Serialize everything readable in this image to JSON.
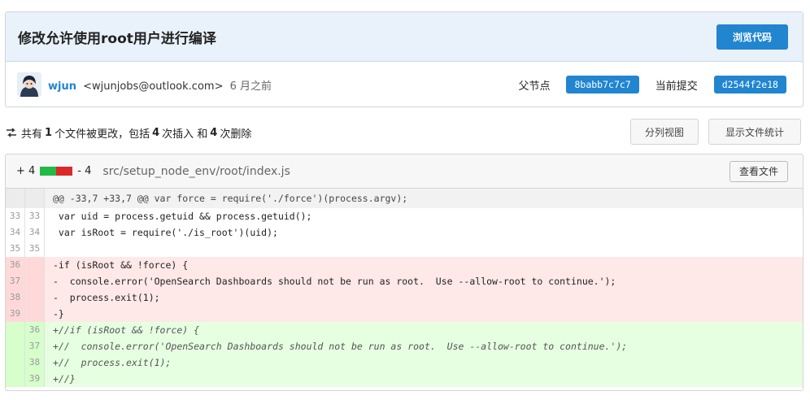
{
  "commit": {
    "title": "修改允许使用root用户进行编译",
    "browse_label": "浏览代码",
    "author_name": "wjun",
    "author_email": "<wjunjobs@outlook.com>",
    "time": "6 月之前",
    "parent_label": "父节点",
    "parent_sha": "8babb7c7c7",
    "current_label": "当前提交",
    "current_sha": "d2544f2e18"
  },
  "stats": {
    "prefix": "共有",
    "files": "1",
    "files_text": "个文件被更改，包括",
    "insertions": "4",
    "insertions_text": "次插入 和",
    "deletions": "4",
    "deletions_text": "次删除",
    "split_label": "分列视图",
    "show_stats_label": "显示文件统计"
  },
  "file": {
    "added": "+ 4",
    "removed": "- 4",
    "path": "src/setup_node_env/root/index.js",
    "view_label": "查看文件"
  },
  "hunk": "@@ -33,7 +33,7 @@ var force = require('./force')(process.argv);",
  "lines": [
    {
      "type": "ctx",
      "old": "33",
      "new": "33",
      "text": " var uid = process.getuid && process.getuid();"
    },
    {
      "type": "ctx",
      "old": "34",
      "new": "34",
      "text": " var isRoot = require('./is_root')(uid);"
    },
    {
      "type": "ctx",
      "old": "35",
      "new": "35",
      "text": " "
    },
    {
      "type": "del",
      "old": "36",
      "new": "",
      "text": "-if (isRoot && !force) {"
    },
    {
      "type": "del",
      "old": "37",
      "new": "",
      "text": "-  console.error('OpenSearch Dashboards should not be run as root.  Use --allow-root to continue.');"
    },
    {
      "type": "del",
      "old": "38",
      "new": "",
      "text": "-  process.exit(1);"
    },
    {
      "type": "del",
      "old": "39",
      "new": "",
      "text": "-}"
    },
    {
      "type": "add",
      "old": "",
      "new": "36",
      "text": "//if (isRoot && !force) {"
    },
    {
      "type": "add",
      "old": "",
      "new": "37",
      "text": "//  console.error('OpenSearch Dashboards should not be run as root.  Use --allow-root to continue.');"
    },
    {
      "type": "add",
      "old": "",
      "new": "38",
      "text": "//  process.exit(1);"
    },
    {
      "type": "add",
      "old": "",
      "new": "39",
      "text": "//}"
    }
  ]
}
